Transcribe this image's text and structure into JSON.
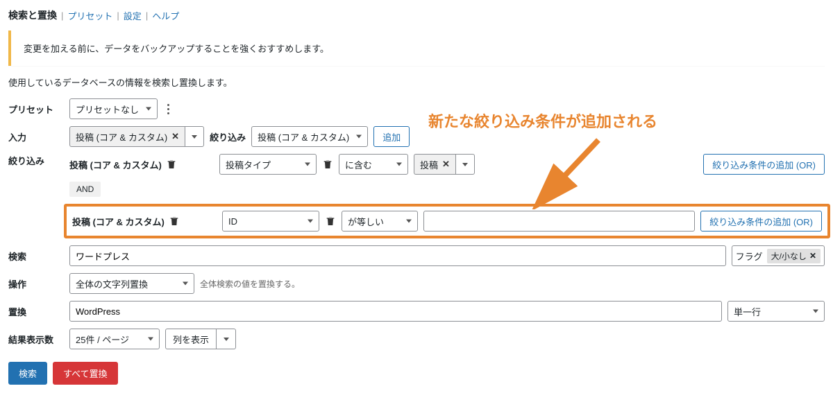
{
  "header": {
    "title": "検索と置換",
    "links": [
      "プリセット",
      "設定",
      "ヘルプ"
    ]
  },
  "notice": "変更を加える前に、データをバックアップすることを強くおすすめします。",
  "description": "使用しているデータベースの情報を検索し置換します。",
  "annotation": "新たな絞り込み条件が追加される",
  "labels": {
    "preset": "プリセット",
    "input": "入力",
    "filter": "絞り込み",
    "search": "検索",
    "operation": "操作",
    "replace": "置換",
    "results": "結果表示数"
  },
  "preset": {
    "value": "プリセットなし"
  },
  "input": {
    "tag": "投稿 (コア & カスタム)",
    "filter_label": "絞り込み",
    "filter_value": "投稿 (コア & カスタム)",
    "add_btn": "追加"
  },
  "filter1": {
    "title": "投稿 (コア & カスタム)",
    "field": "投稿タイプ",
    "op": "に含む",
    "value": "投稿",
    "add_btn": "絞り込み条件の追加 (OR)"
  },
  "and_label": "AND",
  "filter2": {
    "title": "投稿 (コア & カスタム)",
    "field": "ID",
    "op": "が等しい",
    "value": "",
    "add_btn": "絞り込み条件の追加 (OR)"
  },
  "search": {
    "value": "ワードプレス",
    "flag_label": "フラグ",
    "flag_chip": "大/小なし"
  },
  "operation": {
    "value": "全体の文字列置換",
    "hint": "全体検索の値を置換する。"
  },
  "replace": {
    "value": "WordPress",
    "mode": "単一行"
  },
  "results": {
    "per_page": "25件 / ページ",
    "columns": "列を表示"
  },
  "buttons": {
    "search": "検索",
    "replace_all": "すべて置換"
  }
}
